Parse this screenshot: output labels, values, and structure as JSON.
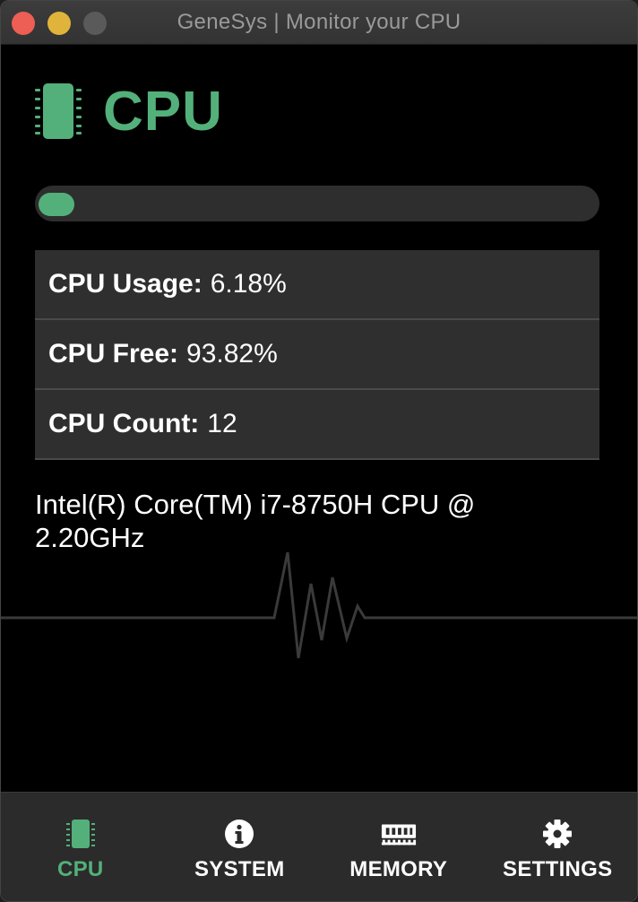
{
  "window": {
    "title": "GeneSys | Monitor your CPU"
  },
  "header": {
    "icon": "cpu-chip-icon",
    "title": "CPU"
  },
  "usage_bar": {
    "value_percent": 6.18,
    "color": "#53b07a"
  },
  "stats": [
    {
      "label": "CPU Usage:",
      "value": "6.18%"
    },
    {
      "label": "CPU Free:",
      "value": "93.82%"
    },
    {
      "label": "CPU Count:",
      "value": "12"
    }
  ],
  "cpu_model": "Intel(R) Core(TM) i7-8750H CPU @ 2.20GHz",
  "nav": [
    {
      "label": "CPU",
      "icon": "cpu-chip-icon",
      "active": true
    },
    {
      "label": "SYSTEM",
      "icon": "info-icon",
      "active": false
    },
    {
      "label": "MEMORY",
      "icon": "memory-icon",
      "active": false
    },
    {
      "label": "SETTINGS",
      "icon": "gear-icon",
      "active": false
    }
  ],
  "colors": {
    "accent": "#53b07a",
    "background": "#000000",
    "panel": "#2f2f2f"
  }
}
